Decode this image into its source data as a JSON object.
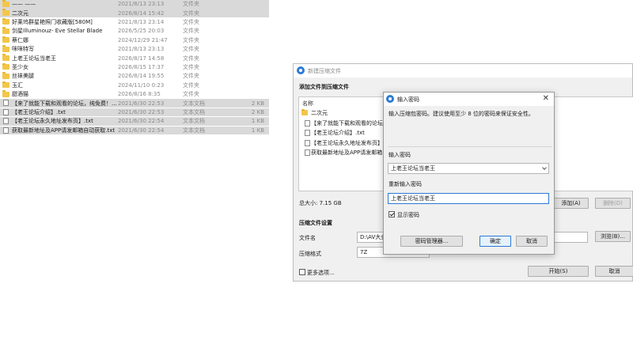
{
  "explorer": {
    "rows": [
      {
        "name": "—— ——",
        "date": "2021/8/13 23:13",
        "type": "文件夹",
        "size": "",
        "icon": "folder-icon",
        "selected": true
      },
      {
        "name": "二次元",
        "date": "2026/8/14 15:42",
        "type": "文件夹",
        "size": "",
        "icon": "folder-icon",
        "selected": true
      },
      {
        "name": "好莱坞群星艳照门收藏版[580M]",
        "date": "2021/8/13 23:14",
        "type": "文件夹",
        "size": "",
        "icon": "folder-icon",
        "selected": false
      },
      {
        "name": "剑星Illuminouz- Eve Stellar Blade",
        "date": "2026/5/25 20:03",
        "type": "文件夹",
        "size": "",
        "icon": "folder-icon",
        "selected": false
      },
      {
        "name": "蔡仁娜",
        "date": "2024/12/29 21:47",
        "type": "文件夹",
        "size": "",
        "icon": "folder-icon",
        "selected": false
      },
      {
        "name": "咪咪特写",
        "date": "2021/8/13 23:13",
        "type": "文件夹",
        "size": "",
        "icon": "folder-icon",
        "selected": false
      },
      {
        "name": "上老王论坛当老王",
        "date": "2026/8/17 14:58",
        "type": "文件夹",
        "size": "",
        "icon": "folder-icon",
        "selected": false
      },
      {
        "name": "圣少女",
        "date": "2026/8/15 17:37",
        "type": "文件夹",
        "size": "",
        "icon": "folder-icon",
        "selected": false
      },
      {
        "name": "丝袜美腿",
        "date": "2026/8/14 19:55",
        "type": "文件夹",
        "size": "",
        "icon": "folder-icon",
        "selected": false
      },
      {
        "name": "玉汇",
        "date": "2024/11/10 0:23",
        "type": "文件夹",
        "size": "",
        "icon": "folder-icon",
        "selected": false
      },
      {
        "name": "甜酒猫",
        "date": "2026/8/16 8:35",
        "type": "文件夹",
        "size": "",
        "icon": "folder-icon",
        "selected": false
      },
      {
        "name": "【来了就能下载和观看的论坛，纯免费！...",
        "date": "2021/6/30 22:53",
        "type": "文本文档",
        "size": "2 KB",
        "icon": "text-file-icon",
        "selected": true
      },
      {
        "name": "【老王论坛介绍】.txt",
        "date": "2021/6/30 22:53",
        "type": "文本文档",
        "size": "2 KB",
        "icon": "text-file-icon",
        "selected": true
      },
      {
        "name": "【老王论坛永久地址发布页】.txt",
        "date": "2021/6/30 22:54",
        "type": "文本文档",
        "size": "1 KB",
        "icon": "text-file-icon",
        "selected": true
      },
      {
        "name": "获取最新地址及APP请发邮箱自动获取.txt",
        "date": "2021/6/30 22:54",
        "type": "文本文档",
        "size": "1 KB",
        "icon": "text-file-icon",
        "selected": true
      }
    ]
  },
  "archive_dialog": {
    "title": "新建压缩文件",
    "add_section_title": "添加文件到压缩文件",
    "list_header": "名称",
    "list_items": [
      {
        "name": "二次元",
        "icon": "folder-icon"
      },
      {
        "name": "【来了就能下载和观看的论坛，纯...",
        "icon": "text-file-icon"
      },
      {
        "name": "【老王论坛介绍】.txt",
        "icon": "text-file-icon"
      },
      {
        "name": "【老王论坛永久地址发布页】.txt",
        "icon": "text-file-icon"
      },
      {
        "name": "获取最新地址及APP请发邮箱自动获...",
        "icon": "text-file-icon"
      }
    ],
    "total_size": "总大小: 7.15 GB",
    "add_button": "添加(A)",
    "remove_button": "删除(D)",
    "settings_section_title": "压缩文件设置",
    "filename_label": "文件名",
    "filename_value": "D:\\AV大业",
    "browse_button": "浏览(B)...",
    "format_label": "压缩格式",
    "format_value": "7Z",
    "more_options_label": "更多选项...",
    "start_button": "开始(S)",
    "cancel_button": "取消"
  },
  "password_dialog": {
    "title": "输入密码",
    "description": "输入压缩包密码。建议使用至少 8 位的密码来保证安全性。",
    "enter_label": "输入密码",
    "enter_value": "上老王论坛当老王",
    "reenter_label": "重新输入密码",
    "reenter_value": "上老王论坛当老王",
    "show_password_label": "显示密码",
    "manager_button": "密码管理器...",
    "ok_button": "确定",
    "cancel_button": "取消"
  },
  "colors": {
    "accent": "#2c7ad6",
    "folder": "#f3c64a",
    "selection": "#d9d9d9",
    "dialog_bg": "#f0f0f0"
  }
}
